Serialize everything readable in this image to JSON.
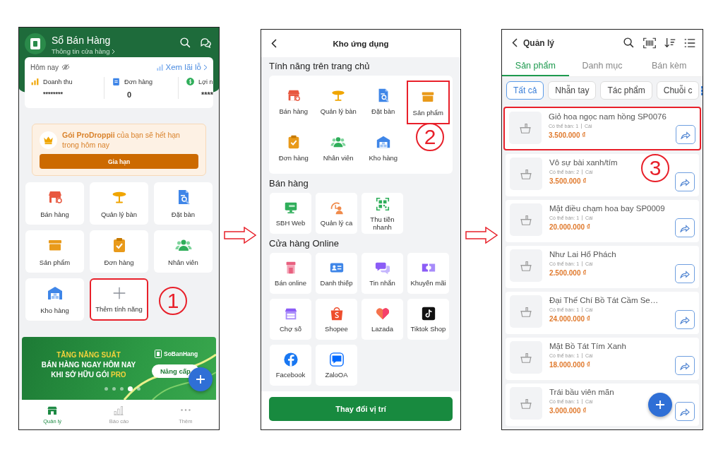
{
  "home": {
    "header": {
      "title": "Sổ Bán Hàng",
      "subtitle": "Thông tin cửa hàng"
    },
    "summary": {
      "period": "Hôm nay",
      "report_link": "Xem lãi lỗ",
      "stats": [
        {
          "label": "Doanh thu",
          "value": "********",
          "kind": "revenue"
        },
        {
          "label": "Đơn hàng",
          "value": "0",
          "kind": "orders"
        },
        {
          "label": "Lợi n",
          "value": "****",
          "kind": "profit"
        }
      ]
    },
    "promo": {
      "message": "**Gói ProDroppii** của bạn sẽ hết hạn trong hôm nay",
      "button": "Gia hạn"
    },
    "features": [
      {
        "label": "Bán hàng",
        "kind": "store",
        "highlighted": false
      },
      {
        "label": "Quản lý bàn",
        "kind": "table",
        "highlighted": false
      },
      {
        "label": "Đặt bàn",
        "kind": "booking",
        "highlighted": false
      },
      {
        "label": "Sản phẩm",
        "kind": "box",
        "highlighted": false
      },
      {
        "label": "Đơn hàng",
        "kind": "order",
        "highlighted": false
      },
      {
        "label": "Nhân viên",
        "kind": "staff",
        "highlighted": false
      },
      {
        "label": "Kho hàng",
        "kind": "warehouse",
        "highlighted": false
      },
      {
        "label": "Thêm tính năng",
        "kind": "add",
        "highlighted": true
      }
    ],
    "banner": {
      "headline": "TĂNG NĂNG SUẤT",
      "lines": [
        {
          "text": "BÁN HÀNG NGAY HÔM NAY"
        },
        {
          "text": "KHI SỞ HỮU GÓI",
          "accent": "PRO"
        }
      ],
      "brand": "SoBanHang",
      "button": "Nâng cấp",
      "dots": [
        {
          "selected": false
        },
        {
          "selected": false
        },
        {
          "selected": false
        },
        {
          "selected": true
        },
        {
          "selected": false
        }
      ]
    },
    "nav": [
      {
        "label": "Quản lý",
        "kind": "manage",
        "selected": true
      },
      {
        "label": "Báo cáo",
        "kind": "report",
        "selected": false
      },
      {
        "label": "Thêm",
        "kind": "more",
        "selected": false
      }
    ],
    "step": "1"
  },
  "app_store": {
    "title": "Kho ứng dụng",
    "sections": [
      {
        "title": "Tính năng trên trang chủ",
        "kind": "panel",
        "items": [
          {
            "label": "Bán hàng",
            "kind": "store",
            "highlighted": false
          },
          {
            "label": "Quản lý bàn",
            "kind": "table",
            "highlighted": false
          },
          {
            "label": "Đặt bàn",
            "kind": "booking",
            "highlighted": false
          },
          {
            "label": "Sản phẩm",
            "kind": "box",
            "highlighted": true
          },
          {
            "label": "Đơn hàng",
            "kind": "order",
            "highlighted": false
          },
          {
            "label": "Nhân viên",
            "kind": "staff",
            "highlighted": false
          },
          {
            "label": "Kho hàng",
            "kind": "warehouse",
            "highlighted": false
          }
        ]
      },
      {
        "title": "Bán hàng",
        "kind": "cards",
        "items": [
          {
            "label": "SBH Web",
            "kind": "web",
            "highlighted": false
          },
          {
            "label": "Quản lý ca",
            "kind": "shift",
            "highlighted": false
          },
          {
            "label": "Thu tiền nhanh",
            "kind": "qr",
            "highlighted": false
          }
        ]
      },
      {
        "title": "Cửa hàng Online",
        "kind": "cards",
        "items": [
          {
            "label": "Bán online",
            "kind": "kiosk",
            "highlighted": false
          },
          {
            "label": "Danh thiếp",
            "kind": "card",
            "highlighted": false
          },
          {
            "label": "Tin nhắn",
            "kind": "chat",
            "highlighted": false
          },
          {
            "label": "Khuyến mãi",
            "kind": "ticket",
            "highlighted": false
          },
          {
            "label": "Chợ số",
            "kind": "market",
            "highlighted": false
          },
          {
            "label": "Shopee",
            "kind": "bag",
            "highlighted": false
          },
          {
            "label": "Lazada",
            "kind": "heart",
            "highlighted": false
          },
          {
            "label": "Tiktok Shop",
            "kind": "note",
            "highlighted": false
          },
          {
            "label": "Facebook",
            "kind": "facebook",
            "highlighted": false
          },
          {
            "label": "ZaloOA",
            "kind": "zalo",
            "highlighted": false
          }
        ]
      }
    ],
    "button": "Thay đổi vị trí",
    "step": "2"
  },
  "product_list": {
    "title": "Quản lý",
    "tabs": [
      {
        "label": "Sản phẩm",
        "selected": true
      },
      {
        "label": "Danh mục",
        "selected": false
      },
      {
        "label": "Bán kèm",
        "selected": false
      }
    ],
    "chips": [
      {
        "label": "Tất cả",
        "selected": true
      },
      {
        "label": "Nhẫn tay",
        "selected": false
      },
      {
        "label": "Tác phẩm",
        "selected": false
      },
      {
        "label": "Chuỗi c",
        "selected": false
      }
    ],
    "items": [
      {
        "name": "Giỏ hoa ngọc nam hồng SP0076",
        "available": "Có thể bán: 1",
        "unit": "Cái",
        "price": "3.500.000 ₫",
        "highlighted": true
      },
      {
        "name": "Vô sự bài xanh/tím",
        "available": "Có thể bán: 2",
        "unit": "Cái",
        "price": "3.500.000 ₫",
        "highlighted": false
      },
      {
        "name": "Mặt điều chạm hoa bay SP0009",
        "available": "Có thể bán: 1",
        "unit": "Cái",
        "price": "20.000.000 ₫",
        "highlighted": false
      },
      {
        "name": "Như Lai Hổ Phách",
        "available": "Có thể bán: 1",
        "unit": "Cái",
        "price": "2.500.000 ₫",
        "highlighted": false
      },
      {
        "name": "Đại Thế Chí Bồ Tát Cầm Se…",
        "available": "Có thể bán: 1",
        "unit": "Cái",
        "price": "24.000.000 ₫",
        "highlighted": false
      },
      {
        "name": "Mặt Bồ Tát Tím Xanh",
        "available": "Có thể bán: 1",
        "unit": "Cái",
        "price": "18.000.000 ₫",
        "highlighted": false
      },
      {
        "name": "Trái bầu viên mãn",
        "available": "Có thể bán: 1",
        "unit": "Cái",
        "price": "3.000.000 ₫",
        "highlighted": false
      }
    ],
    "step": "3"
  }
}
